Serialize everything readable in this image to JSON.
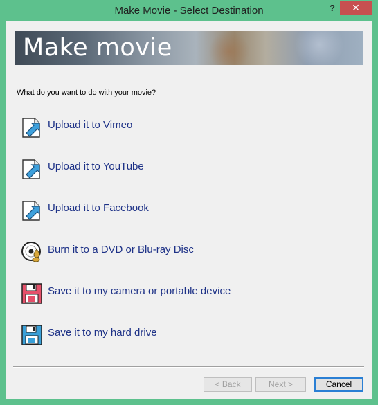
{
  "window": {
    "title": "Make Movie - Select Destination",
    "help_glyph": "?",
    "close_glyph": "✕"
  },
  "banner": {
    "title": "Make movie"
  },
  "prompt": "What do you want to do with your movie?",
  "options": [
    {
      "label": "Upload it to Vimeo",
      "icon": "upload-icon"
    },
    {
      "label": "Upload it to YouTube",
      "icon": "upload-icon"
    },
    {
      "label": "Upload it to Facebook",
      "icon": "upload-icon"
    },
    {
      "label": "Burn it to a DVD or Blu-ray Disc",
      "icon": "disc-icon"
    },
    {
      "label": "Save it to my camera or portable device",
      "icon": "floppy-red-icon"
    },
    {
      "label": "Save it to my hard drive",
      "icon": "floppy-blue-icon"
    }
  ],
  "buttons": {
    "back": "< Back",
    "next": "Next >",
    "cancel": "Cancel"
  },
  "colors": {
    "frame": "#5dc18d",
    "close": "#c75050",
    "link": "#1e3287"
  }
}
